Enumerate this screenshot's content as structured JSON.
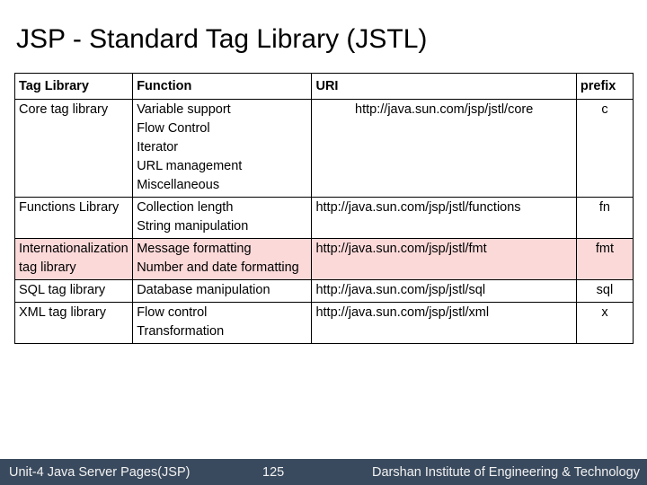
{
  "slide": {
    "title": "JSP - Standard Tag Library (JSTL)"
  },
  "table": {
    "headers": {
      "tag_library": "Tag Library",
      "function": "Function",
      "uri": "URI",
      "prefix": "prefix"
    },
    "rows": [
      {
        "tag_library": "Core tag library",
        "function": "Variable support\nFlow Control\nIterator\nURL management\nMiscellaneous",
        "uri": "http://java.sun.com/jsp/jstl/core",
        "prefix": "c",
        "highlight": false,
        "uri_align": "center"
      },
      {
        "tag_library": "Functions Library",
        "function": "Collection length\nString manipulation",
        "uri": "http://java.sun.com/jsp/jstl/functions",
        "prefix": "fn",
        "highlight": false,
        "uri_align": "left"
      },
      {
        "tag_library": "Internationalization tag library",
        "function": "Message formatting\nNumber and date formatting",
        "uri": "http://java.sun.com/jsp/jstl/fmt",
        "prefix": "fmt",
        "highlight": true,
        "uri_align": "left"
      },
      {
        "tag_library": "SQL tag library",
        "function": "Database manipulation",
        "uri": "http://java.sun.com/jsp/jstl/sql",
        "prefix": "sql",
        "highlight": false,
        "uri_align": "left"
      },
      {
        "tag_library": "XML tag library",
        "function": "Flow control\nTransformation",
        "uri": "http://java.sun.com/jsp/jstl/xml",
        "prefix": "x",
        "highlight": false,
        "uri_align": "left"
      }
    ]
  },
  "footer": {
    "left_text": "Unit-4 Java Server Pages(JSP)",
    "page_number": "125",
    "right_text": "Darshan Institute of Engineering & Technology",
    "background_color": "#3A4A5E",
    "text_color": "#F2F2F2"
  },
  "colors": {
    "highlight_row": "#FCD9D9",
    "table_border": "#000000",
    "page_background": "#FFFFFF"
  }
}
